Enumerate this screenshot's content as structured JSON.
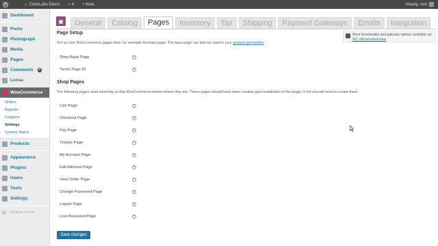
{
  "adminbar": {
    "site_name": "ColorLabs Demo",
    "comments_count": "4",
    "new_label": "+ New",
    "howdy": "Howdy, root"
  },
  "sidebar": {
    "items": [
      {
        "label": "Dashboard",
        "icon": "dashboard-icon"
      },
      {
        "label": "Posts",
        "icon": "posts-icon"
      },
      {
        "label": "Photograph",
        "icon": "photograph-icon"
      },
      {
        "label": "Media",
        "icon": "media-icon"
      },
      {
        "label": "Pages",
        "icon": "pages-icon"
      },
      {
        "label": "Comments",
        "icon": "comments-icon",
        "badge": "4"
      },
      {
        "label": "Lensa",
        "icon": "lensa-icon"
      },
      {
        "label": "WooCommerce",
        "icon": "woocommerce-icon"
      }
    ],
    "woo_sub": [
      "Orders",
      "Reports",
      "Coupons",
      "Settings",
      "System Status"
    ],
    "items2": [
      {
        "label": "Products",
        "icon": "products-icon"
      },
      {
        "label": "Appearance",
        "icon": "appearance-icon"
      },
      {
        "label": "Plugins",
        "icon": "plugins-icon"
      },
      {
        "label": "Users",
        "icon": "users-icon"
      },
      {
        "label": "Tools",
        "icon": "tools-icon"
      },
      {
        "label": "Settings",
        "icon": "settings-icon"
      }
    ],
    "collapse": "Collapse menu"
  },
  "tabs": [
    "General",
    "Catalog",
    "Pages",
    "Inventory",
    "Tax",
    "Shipping",
    "Payment Gateways",
    "Emails",
    "Integration"
  ],
  "active_tab": "Pages",
  "notice": {
    "text": "More functionality and gateway options available via",
    "link": "WC official extensions"
  },
  "page_setup": {
    "title": "Page Setup",
    "desc": "Set up core WooCommerce pages here, for example the base page. The base page can also be used in your",
    "link": "product permalinks",
    "desc_end": ".",
    "rows": [
      "Shop Base Page",
      "Terms Page ID"
    ]
  },
  "shop_pages": {
    "title": "Shop Pages",
    "desc": "The following pages need selecting so that WooCommerce knows where they are. These pages should have been created upon installation of the plugin, if not you will need to create them.",
    "rows": [
      "Cart Page",
      "Checkout Page",
      "Pay Page",
      "Thanks Page",
      "My Account Page",
      "Edit Address Page",
      "View Order Page",
      "Change Password Page",
      "Logout Page",
      "Lost Password Page"
    ]
  },
  "save_label": "Save changes",
  "colors": {
    "accent": "#21759b",
    "adminbar": "#464646",
    "woo_purple": "#8a4f7d"
  }
}
